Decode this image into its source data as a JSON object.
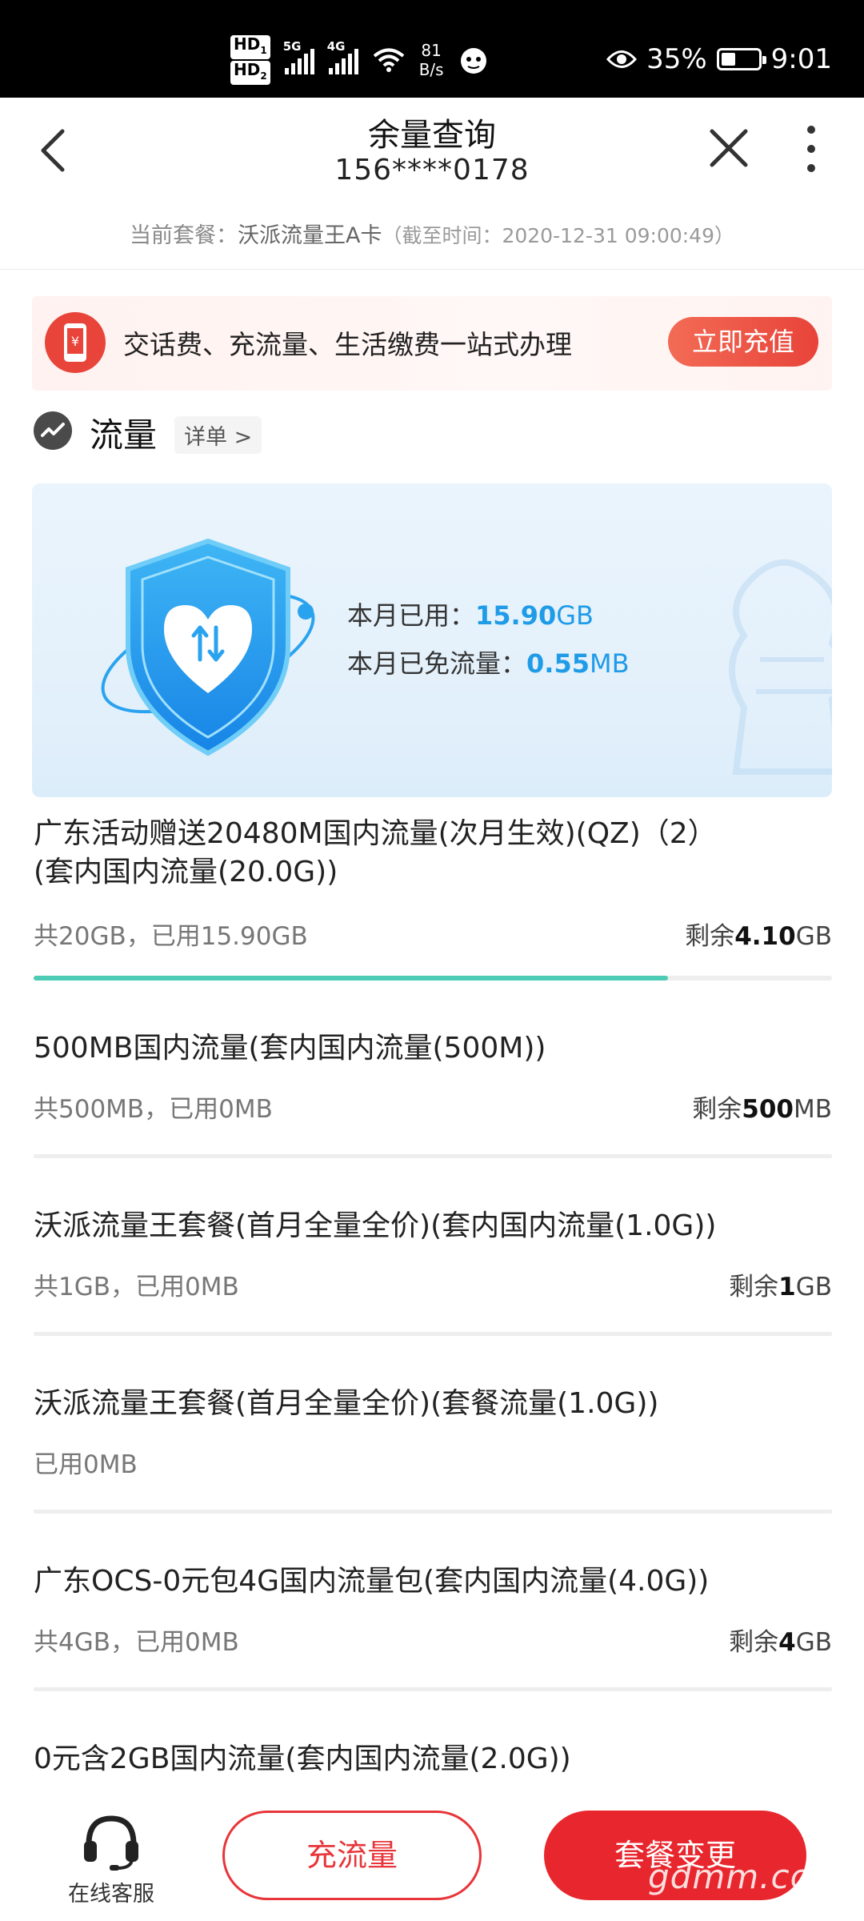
{
  "status_bar": {
    "hd1": "HD",
    "hd1_sub": "1",
    "hd2": "HD",
    "hd2_sub": "2",
    "net1": "5G",
    "net2": "4G",
    "speed_value": "81",
    "speed_unit": "B/s",
    "battery": "35%",
    "time": "9:01"
  },
  "header": {
    "title": "余量查询",
    "phone": "156****0178",
    "plan_label": "当前套餐：",
    "plan_name": "沃派流量王A卡",
    "plan_time": "（截至时间：2020-12-31 09:00:49）"
  },
  "promo": {
    "icon_glyph": "¥",
    "text": "交话费、充流量、生活缴费一站式办理",
    "button": "立即充值"
  },
  "traffic_section": {
    "title": "流量",
    "detail_link": "详单 >"
  },
  "usage_card": {
    "used_label": "本月已用：",
    "used_value": "15.90",
    "used_unit": "GB",
    "free_label": "本月已免流量：",
    "free_value": "0.55",
    "free_unit": "MB"
  },
  "packages": [
    {
      "name_line1": "广东活动赠送20480M国内流量(次月生效)(QZ)（2）",
      "name_line2": "(套内国内流量(20.0G))",
      "meta": "共20GB，已用15.90GB",
      "remain_label": "剩余",
      "remain_value": "4.10",
      "remain_unit": "GB",
      "used_fraction": 0.795
    },
    {
      "name_line1": "500MB国内流量(套内国内流量(500M))",
      "meta": "共500MB，已用0MB",
      "remain_label": "剩余",
      "remain_value": "500",
      "remain_unit": "MB"
    },
    {
      "name_line1": "沃派流量王套餐(首月全量全价)(套内国内流量(1.0G))",
      "meta": "共1GB，已用0MB",
      "remain_label": "剩余",
      "remain_value": "1",
      "remain_unit": "GB"
    },
    {
      "name_line1": "沃派流量王套餐(首月全量全价)(套餐流量(1.0G))",
      "meta": "已用0MB"
    },
    {
      "name_line1": "广东OCS-0元包4G国内流量包(套内国内流量(4.0G))",
      "meta": "共4GB，已用0MB",
      "remain_label": "剩余",
      "remain_value": "4",
      "remain_unit": "GB"
    },
    {
      "name_line1": "0元含2GB国内流量(套内国内流量(2.0G))"
    }
  ],
  "bottom_bar": {
    "service_label": "在线客服",
    "recharge_button": "充流量",
    "change_button": "套餐变更",
    "watermark": "gdmm.com"
  },
  "colors": {
    "accent_red": "#e8262d",
    "used_blue": "#1f9be8",
    "progress_teal": "#4ecbb4"
  }
}
